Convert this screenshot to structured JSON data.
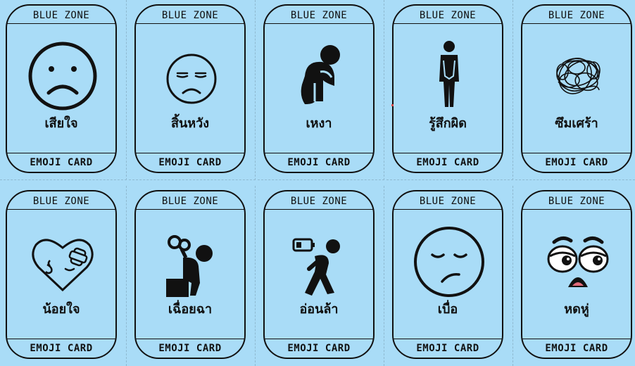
{
  "zone_label": "BLUE ZONE",
  "card_footer": "EMOJI CARD",
  "cards": [
    {
      "label": "เสียใจ",
      "icon": "sad-face-icon"
    },
    {
      "label": "สิ้นหวัง",
      "icon": "hopeless-face-icon"
    },
    {
      "label": "เหงา",
      "icon": "lonely-person-icon"
    },
    {
      "label": "รู้สึกผิด",
      "icon": "guilty-person-icon"
    },
    {
      "label": "ซึมเศร้า",
      "icon": "tangled-scribble-icon"
    },
    {
      "label": "น้อยใจ",
      "icon": "bandaged-heart-icon"
    },
    {
      "label": "เฉื่อยฉา",
      "icon": "sluggish-person-icon"
    },
    {
      "label": "อ่อนล้า",
      "icon": "tired-person-battery-icon"
    },
    {
      "label": "เบื่อ",
      "icon": "bored-face-icon"
    },
    {
      "label": "หดหู่",
      "icon": "gloomy-eyes-icon"
    }
  ],
  "colors": {
    "background": "#a9dcf7",
    "ink": "#111111"
  }
}
